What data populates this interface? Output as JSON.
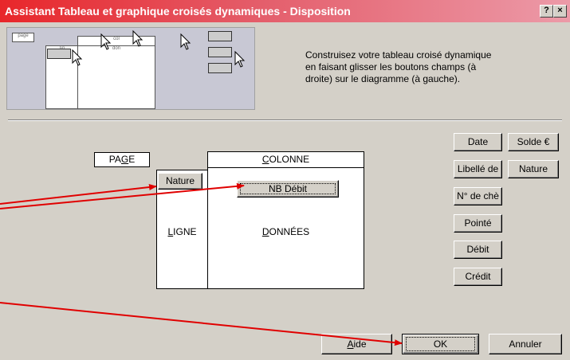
{
  "window": {
    "title": "Assistant Tableau et graphique croisés dynamiques - Disposition",
    "help_button": "?",
    "close_button": "×"
  },
  "preview": {
    "box_labels": [
      "page",
      "col",
      "lig",
      "don"
    ],
    "btn_labels": [
      "",
      "",
      ""
    ]
  },
  "instruction": "Construisez votre tableau croisé dynamique en faisant glisser les boutons champs (à droite) sur le diagramme (à gauche).",
  "layout": {
    "page_label": "PAGE",
    "page_accel": "G",
    "column_label": "COLONNE",
    "column_accel": "C",
    "row_label": "LIGNE",
    "row_accel": "L",
    "data_label": "DONNÉES",
    "data_accel": "D",
    "row_field": "Nature",
    "data_field": "NB Débit"
  },
  "fields": [
    {
      "label": "Date"
    },
    {
      "label": "Solde €"
    },
    {
      "label": "Libellé de"
    },
    {
      "label": "Nature"
    },
    {
      "label": "N° de chè"
    },
    {
      "label": "Pointé"
    },
    {
      "label": "Débit"
    },
    {
      "label": "Crédit"
    }
  ],
  "buttons": {
    "help": "Aide",
    "ok": "OK",
    "cancel": "Annuler"
  },
  "colors": {
    "arrow": "#e00000",
    "title_start": "#e8262a",
    "title_end": "#ec9aa8",
    "face": "#d4d0c8"
  }
}
